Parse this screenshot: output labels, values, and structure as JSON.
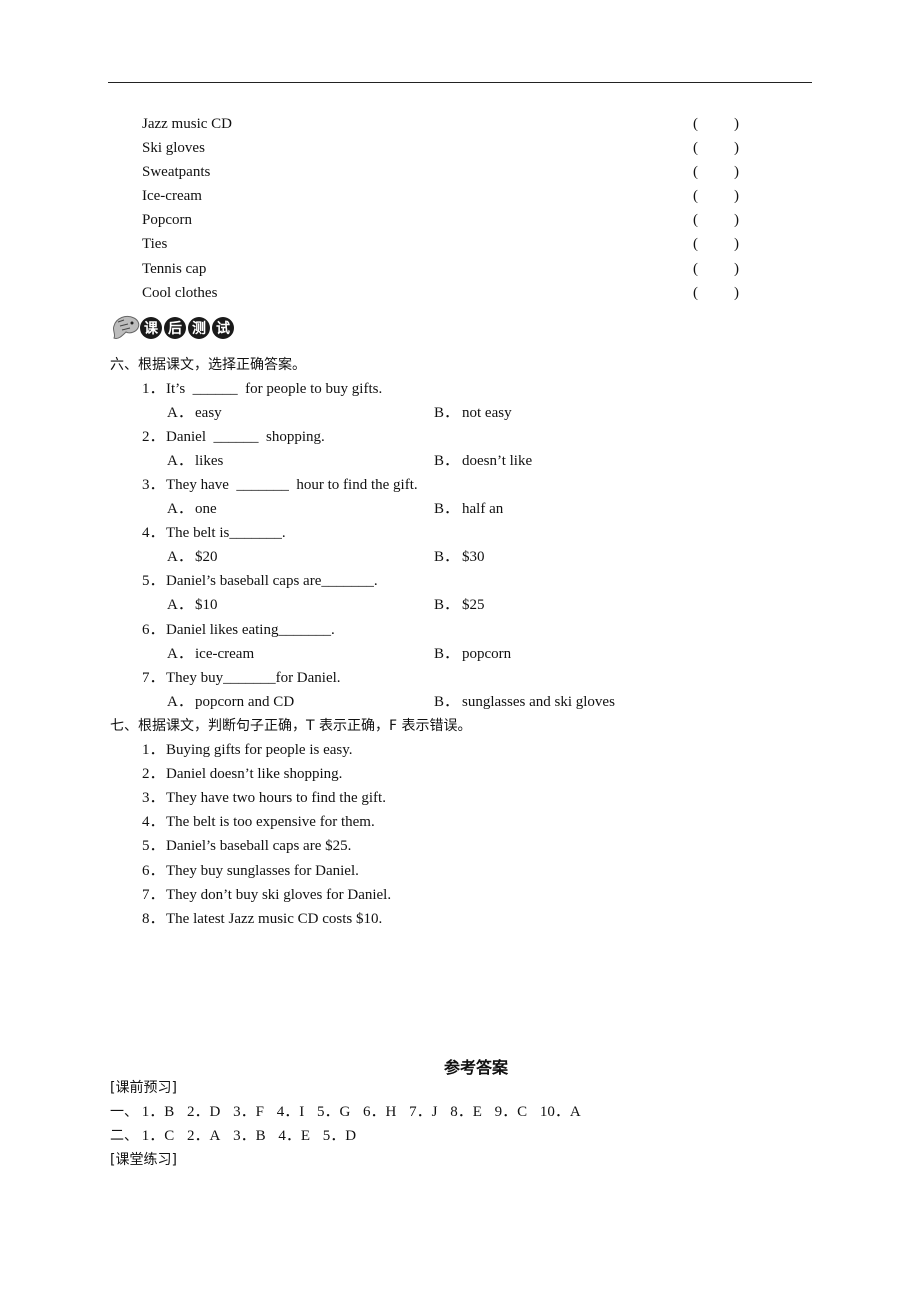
{
  "items": [
    {
      "name": "Jazz music CD",
      "open": "(",
      "close": ")"
    },
    {
      "name": "Ski gloves",
      "open": "(",
      "close": ")"
    },
    {
      "name": "Sweatpants",
      "open": "(",
      "close": ")"
    },
    {
      "name": "Ice-cream",
      "open": "(",
      "close": ")"
    },
    {
      "name": "Popcorn",
      "open": "(",
      "close": ")"
    },
    {
      "name": "Ties",
      "open": "(",
      "close": ")"
    },
    {
      "name": "Tennis cap",
      "open": "(",
      "close": ")"
    },
    {
      "name": "Cool clothes",
      "open": "(",
      "close": ")"
    }
  ],
  "banner": {
    "chars": [
      "课",
      "后",
      "测",
      "试"
    ],
    "icon": "mascot-icon"
  },
  "section6": {
    "heading": "六、根据课文，选择正确答案。",
    "questions": [
      {
        "num": "1．",
        "text": "It’s  ______  for people to buy gifts.",
        "a_label": "A．",
        "a": "easy",
        "b_label": "B．",
        "b": "not easy"
      },
      {
        "num": "2．",
        "text": "Daniel  ______  shopping.",
        "a_label": "A．",
        "a": "likes",
        "b_label": "B．",
        "b": "doesn’t like"
      },
      {
        "num": "3．",
        "text": "They have  _______  hour to find the gift.",
        "a_label": "A．",
        "a": "one",
        "b_label": "B．",
        "b": "half an"
      },
      {
        "num": "4．",
        "text": "The belt is_______.",
        "a_label": "A．",
        "a": "$20",
        "b_label": "B．",
        "b": "$30"
      },
      {
        "num": "5．",
        "text": "Daniel’s baseball caps are_______.",
        "a_label": "A．",
        "a": "$10",
        "b_label": "B．",
        "b": "$25"
      },
      {
        "num": "6．",
        "text": "Daniel likes eating_______.",
        "a_label": "A．",
        "a": "ice-cream",
        "b_label": "B．",
        "b": "popcorn"
      },
      {
        "num": "7．",
        "text": "They buy_______for Daniel.",
        "a_label": "A．",
        "a": "popcorn and CD",
        "b_label": "B．",
        "b": "sunglasses and ski gloves"
      }
    ]
  },
  "section7": {
    "heading": "七、根据课文，判断句子正确，T 表示正确，F 表示错误。",
    "statements": [
      {
        "num": "1．",
        "text": "Buying gifts for people is easy."
      },
      {
        "num": "2．",
        "text": "Daniel doesn’t like shopping."
      },
      {
        "num": "3．",
        "text": "They have two hours to find the gift."
      },
      {
        "num": "4．",
        "text": "The belt is too expensive for them."
      },
      {
        "num": "5．",
        "text": "Daniel’s baseball caps are $25."
      },
      {
        "num": "6．",
        "text": "They buy sunglasses for Daniel."
      },
      {
        "num": "7．",
        "text": "They don’t buy ski gloves for Daniel."
      },
      {
        "num": "8．",
        "text": "The latest Jazz music CD costs $10."
      }
    ]
  },
  "answers": {
    "title": "参考答案",
    "preview_label": "[课前预习]",
    "row1_prefix": "一、",
    "row1": [
      "1．B",
      "2．D",
      "3．F",
      "4．I",
      "5．G",
      "6．H",
      "7．J",
      "8．E",
      "9．C",
      "10．A"
    ],
    "row2_prefix": "二、",
    "row2": [
      "1．C",
      "2．A",
      "3．B",
      "4．E",
      "5．D"
    ],
    "practice_label": "[课堂练习]"
  }
}
